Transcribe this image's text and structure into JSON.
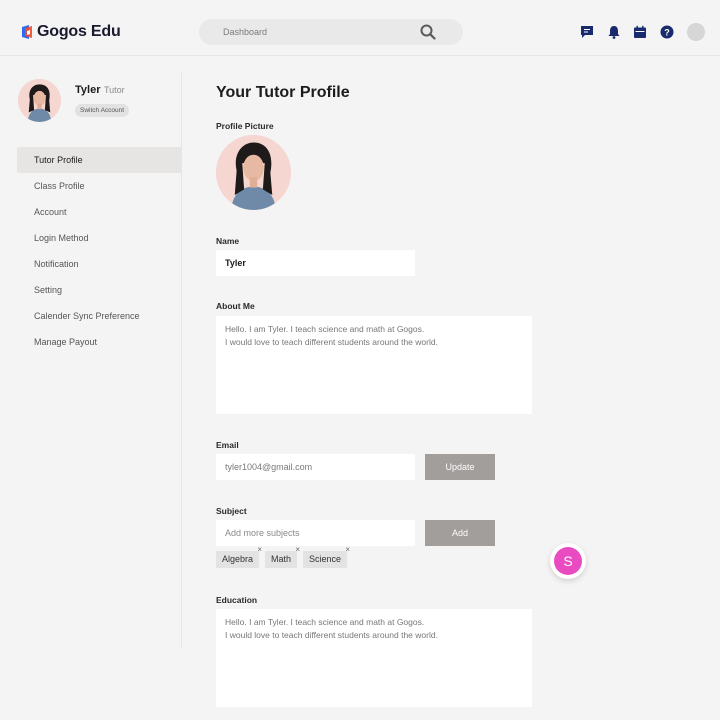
{
  "header": {
    "app_name": "Gogos Edu",
    "search_placeholder": "Dashboard",
    "icons": [
      "chat-icon",
      "bell-icon",
      "calendar-icon",
      "help-icon",
      "avatar"
    ],
    "brand_color": "#1a2b6d"
  },
  "sidebar": {
    "user_name": "Tyler",
    "user_role": "Tutor",
    "switch_label": "Switch Account",
    "items": [
      {
        "label": "Tutor Profile",
        "active": true
      },
      {
        "label": "Class Profile"
      },
      {
        "label": "Account"
      },
      {
        "label": "Login Method"
      },
      {
        "label": "Notification"
      },
      {
        "label": "Setting"
      },
      {
        "label": "Calender Sync Preference"
      },
      {
        "label": "Manage Payout"
      }
    ]
  },
  "main": {
    "title": "Your Tutor Profile",
    "profile_picture_label": "Profile Picture",
    "name_label": "Name",
    "name_value": "Tyler",
    "about_label": "About Me",
    "about_text": "Hello. I am Tyler. I teach science and math at Gogos.\nI would love to teach different students around the world.",
    "email_label": "Email",
    "email_value": "tyler1004@gmail.com",
    "update_label": "Update",
    "subject_label": "Subject",
    "subject_placeholder": "Add more subjects",
    "add_label": "Add",
    "subjects": [
      "Algebra",
      "Math",
      "Science"
    ],
    "remove_glyph": "×",
    "education_label": "Education",
    "education_text": "Hello. I am Tyler. I teach science and math at Gogos.\nI would love to teach different students around the world."
  },
  "fab": {
    "letter": "S",
    "color": "#e94bc1"
  }
}
